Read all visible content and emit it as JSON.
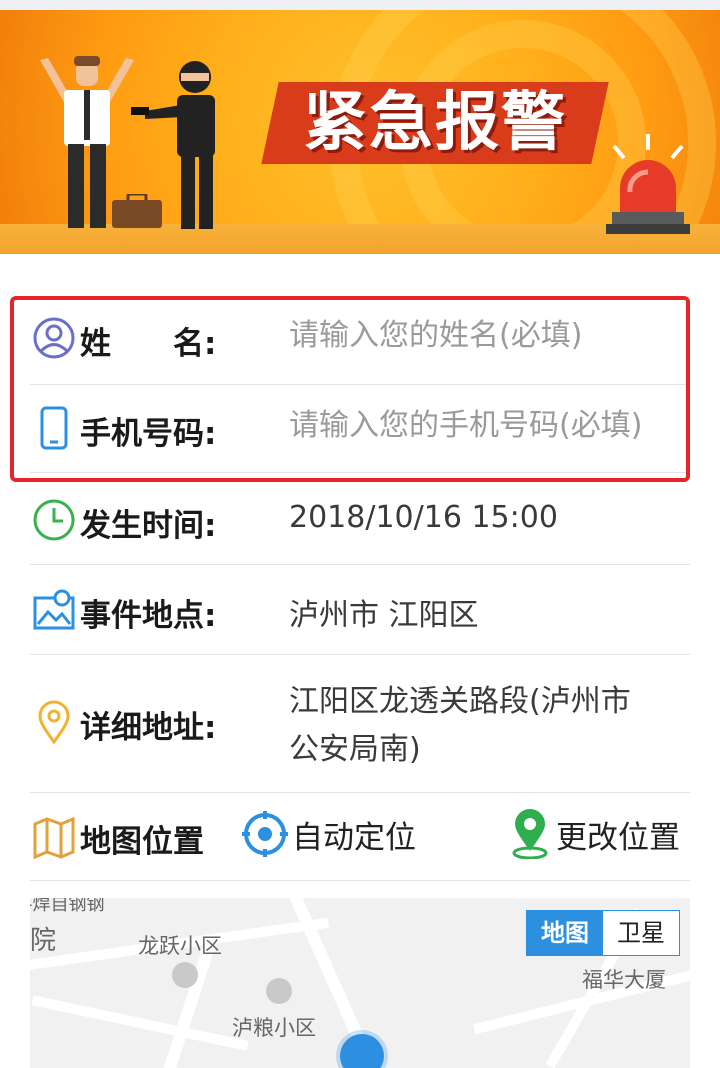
{
  "banner": {
    "title": "紧急报警"
  },
  "form": {
    "name": {
      "label": "姓　　名:",
      "placeholder": "请输入您的姓名(必填)"
    },
    "phone": {
      "label": "手机号码:",
      "placeholder": "请输入您的手机号码(必填)"
    },
    "time": {
      "label": "发生时间:",
      "value": "2018/10/16 15:00"
    },
    "location": {
      "label": "事件地点:",
      "value": "泸州市 江阳区"
    },
    "address": {
      "label": "详细地址:",
      "line1": "江阳区龙透关路段(泸州市",
      "line2": "公安局南)"
    },
    "map_position": {
      "label": "地图位置",
      "auto_locate": "自动定位",
      "change_position": "更改位置"
    }
  },
  "map": {
    "tabs": {
      "map": "地图",
      "satellite": "卫星",
      "active": "地图"
    },
    "pois": [
      "龙跃小区",
      "福华大厦",
      "泸粮小区"
    ],
    "partial_labels": [
      "院",
      "-焊自钢钢"
    ]
  },
  "colors": {
    "banner_red": "#d83c1a",
    "highlight_red": "#e5252a",
    "accent_blue": "#2d8fe0",
    "clock_green": "#37b24d",
    "pin_green": "#2fae4e"
  }
}
